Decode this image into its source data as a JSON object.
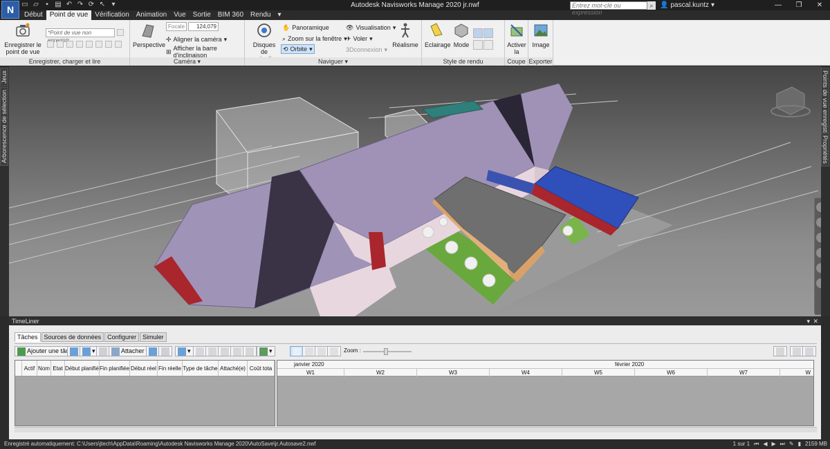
{
  "app": {
    "logo_letter": "N",
    "window_title": "Autodesk Navisworks Manage 2020    jr.nwf",
    "search_placeholder": "Entrez mot-clé ou expression",
    "user": "pascal.kuntz"
  },
  "ribbon_tabs": [
    "Début",
    "Point de vue",
    "Vérification",
    "Animation",
    "Vue",
    "Sortie",
    "BIM 360",
    "Rendu"
  ],
  "active_tab": "Point de vue",
  "ribbon": {
    "groups": {
      "enregistrer": "Enregistrer, charger et lire",
      "camera": "Caméra",
      "naviguer": "Naviguer",
      "style": "Style de rendu",
      "coupe": "Coupe",
      "exporter": "Exporter"
    },
    "save_viewpoint": "Enregistrer le point de vue",
    "viewpoint_combo": "*Point de vue non enregistr",
    "perspective": "Perspective",
    "focale_label": "Focale",
    "focale_value": "124,079",
    "align_camera": "Aligner la caméra",
    "show_tilt_bar": "Afficher la barre d'inclinaison",
    "nav_wheels": "Disques de navigation",
    "panoramique": "Panoramique",
    "zoom_window": "Zoom sur la fenêtre",
    "orbite": "Orbite",
    "visualisation": "Visualisation",
    "voler": "Voler",
    "connexion3d": "3Dconnexion",
    "realisme": "Réalisme",
    "eclairage": "Eclairage",
    "mode": "Mode",
    "activer_coupe": "Activer la coupe",
    "image": "Image"
  },
  "side_tabs": {
    "left": [
      "Jeux",
      "Arborescence de sélection"
    ],
    "right": [
      "Points de vue enregistrés",
      "Propriétés"
    ]
  },
  "timeliner": {
    "title": "TimeLiner",
    "tabs": [
      "Tâches",
      "Sources de données",
      "Configurer",
      "Simuler"
    ],
    "active_tab": "Tâches",
    "add_task": "Ajouter une tâche",
    "attach": "Attacher",
    "zoom_label": "Zoom :",
    "columns": [
      "Actif",
      "Nom",
      "Etat",
      "Début planifié",
      "Fin planifiée",
      "Début réel",
      "Fin réelle",
      "Type de tâche",
      "Attaché(e)",
      "Coût tota"
    ],
    "months": [
      "janvier 2020",
      "février 2020"
    ],
    "weeks": [
      "W1",
      "W2",
      "W3",
      "W4",
      "W5",
      "W6",
      "W7",
      "W"
    ]
  },
  "status": {
    "autosave": "Enregistré automatiquement: C:\\Users\\jtech\\AppData\\Roaming\\Autodesk Navisworks Manage 2020\\AutoSave\\jr.Autosave2.nwf",
    "page": "1 sur 1",
    "memory": "2159 MB"
  }
}
